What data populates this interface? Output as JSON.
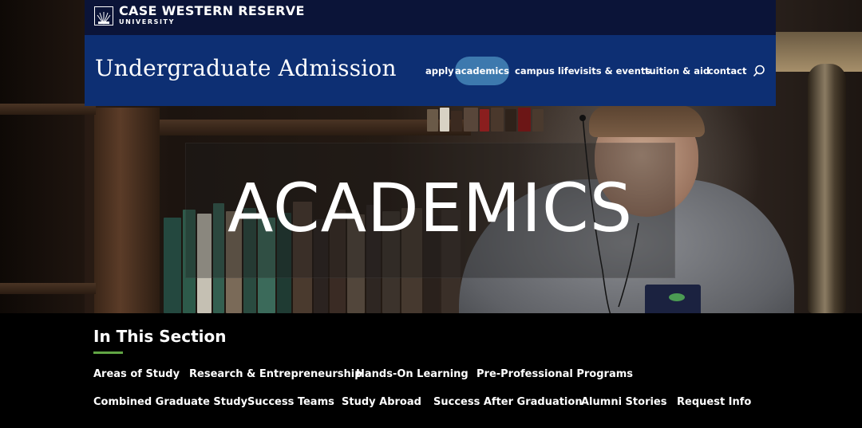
{
  "university": {
    "name": "CASE WESTERN RESERVE",
    "subname": "UNIVERSITY"
  },
  "site": {
    "title": "Undergraduate Admission"
  },
  "nav": {
    "items": [
      {
        "label": "apply",
        "active": false
      },
      {
        "label": "academics",
        "active": true
      },
      {
        "label": "campus life",
        "active": false
      },
      {
        "label": "visits & events",
        "active": false
      },
      {
        "label": "tuition & aid",
        "active": false
      },
      {
        "label": "contact",
        "active": false
      }
    ],
    "search_icon": "search-icon"
  },
  "hero": {
    "title": "ACADEMICS"
  },
  "section": {
    "title": "In This Section",
    "links_row1": [
      "Areas of Study",
      "Research & Entrepreneurship",
      "Hands-On Learning",
      "Pre-Professional Programs"
    ],
    "links_row2": [
      "Combined Graduate Study",
      "Success Teams",
      "Study Abroad",
      "Success After Graduation",
      "Alumni Stories",
      "Request Info"
    ]
  },
  "colors": {
    "univ_bar": "#0b1438",
    "header": "#0d2f73",
    "active_pill": "#3d79ae",
    "accent_rule": "#61a544"
  }
}
